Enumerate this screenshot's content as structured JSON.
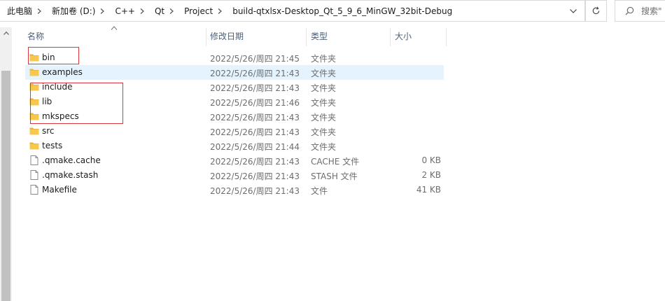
{
  "breadcrumb": [
    "此电脑",
    "新加卷 (D:)",
    "C++",
    "Qt",
    "Project",
    "build-qtxlsx-Desktop_Qt_5_9_6_MinGW_32bit-Debug"
  ],
  "search": {
    "placeholder": "搜索\""
  },
  "columns": {
    "name": "名称",
    "date": "修改日期",
    "type": "类型",
    "size": "大小"
  },
  "colors": {
    "folder": "#f6c94e",
    "folder_dark": "#e8b53a",
    "highlight": "#e5f3ff",
    "annotation": "#d9363e",
    "header_text": "#4c607a"
  },
  "files": [
    {
      "name": "bin",
      "date": "2022/5/26/周四 21:45",
      "type": "文件夹",
      "size": "",
      "icon": "folder-icon"
    },
    {
      "name": "examples",
      "date": "2022/5/26/周四 21:43",
      "type": "文件夹",
      "size": "",
      "icon": "folder-icon",
      "highlighted": true
    },
    {
      "name": "include",
      "date": "2022/5/26/周四 21:43",
      "type": "文件夹",
      "size": "",
      "icon": "folder-icon"
    },
    {
      "name": "lib",
      "date": "2022/5/26/周四 21:46",
      "type": "文件夹",
      "size": "",
      "icon": "folder-icon"
    },
    {
      "name": "mkspecs",
      "date": "2022/5/26/周四 21:43",
      "type": "文件夹",
      "size": "",
      "icon": "folder-icon"
    },
    {
      "name": "src",
      "date": "2022/5/26/周四 21:43",
      "type": "文件夹",
      "size": "",
      "icon": "folder-icon"
    },
    {
      "name": "tests",
      "date": "2022/5/26/周四 21:44",
      "type": "文件夹",
      "size": "",
      "icon": "folder-icon"
    },
    {
      "name": ".qmake.cache",
      "date": "2022/5/26/周四 21:43",
      "type": "CACHE 文件",
      "size": "0 KB",
      "icon": "file-icon"
    },
    {
      "name": ".qmake.stash",
      "date": "2022/5/26/周四 21:43",
      "type": "STASH 文件",
      "size": "2 KB",
      "icon": "file-icon"
    },
    {
      "name": "Makefile",
      "date": "2022/5/26/周四 21:43",
      "type": "文件",
      "size": "41 KB",
      "icon": "file-icon"
    }
  ]
}
